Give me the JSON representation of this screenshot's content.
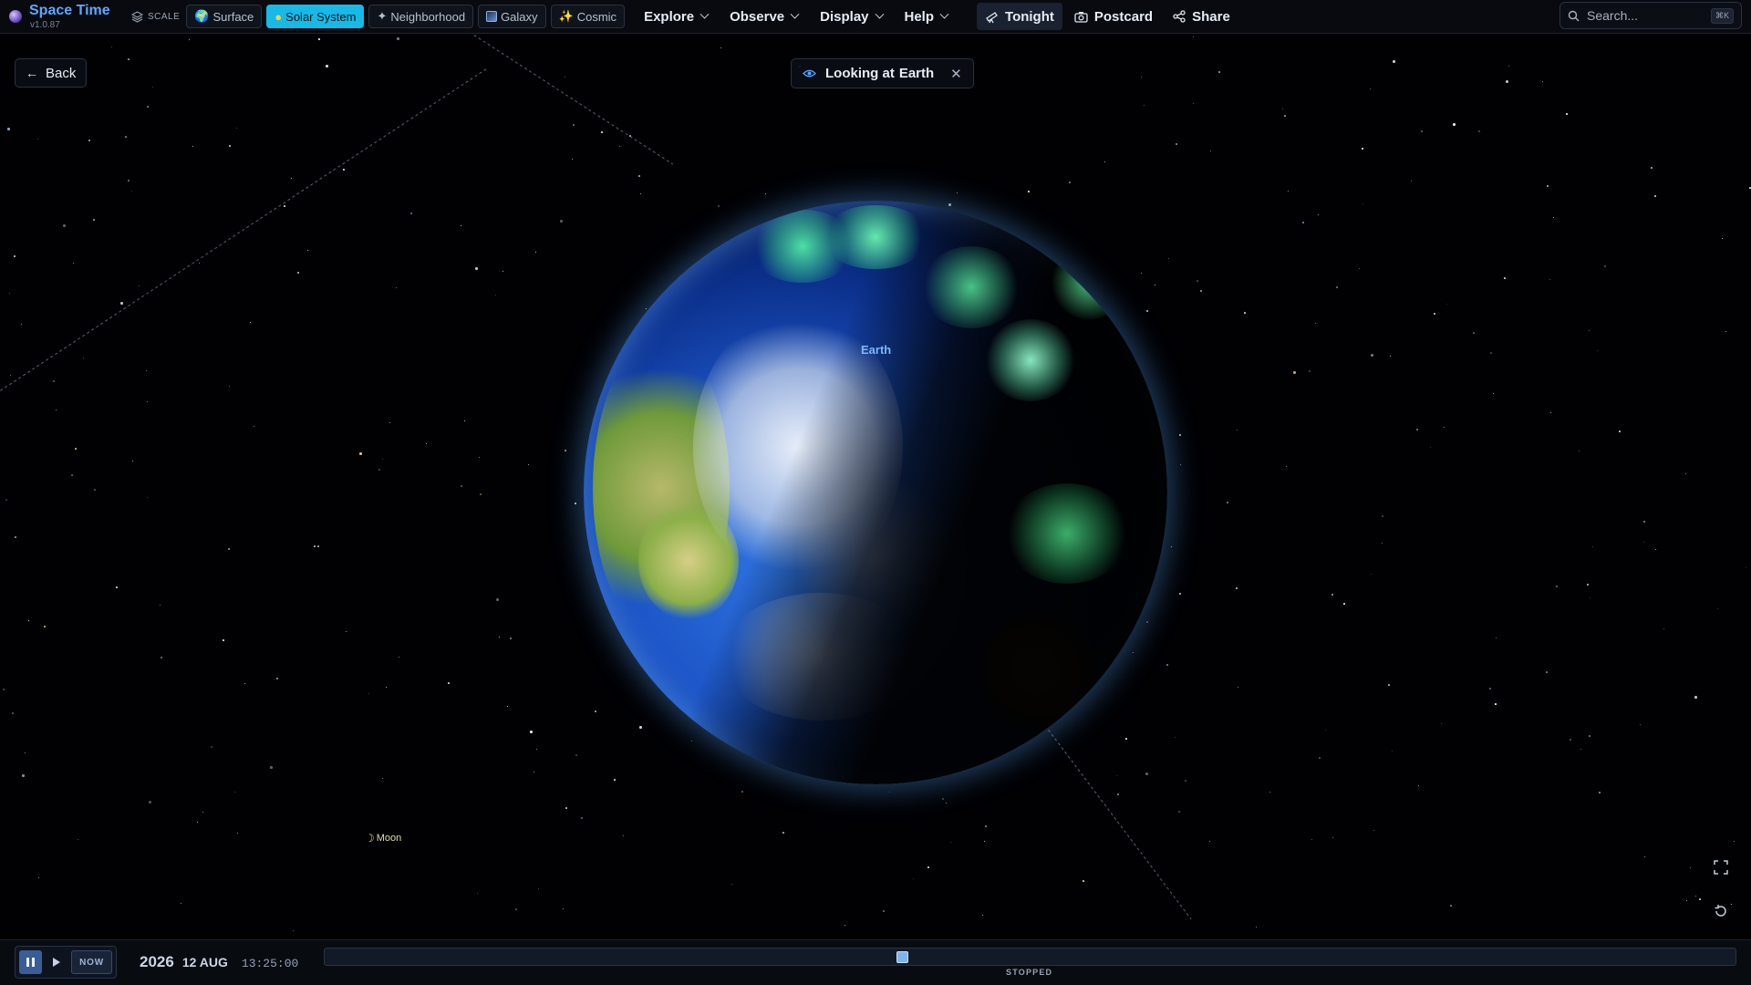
{
  "app": {
    "title": "Space Time",
    "version": "v1.0.87"
  },
  "scale": {
    "label": "SCALE",
    "options": [
      {
        "label": "Surface",
        "icon": "globe-icon",
        "active": false
      },
      {
        "label": "Solar System",
        "icon": "sun-icon",
        "active": true
      },
      {
        "label": "Neighborhood",
        "icon": "sparkle-icon",
        "active": false
      },
      {
        "label": "Galaxy",
        "icon": "galaxy-icon",
        "active": false
      },
      {
        "label": "Cosmic",
        "icon": "cosmic-icon",
        "active": false
      }
    ]
  },
  "menus": [
    "Explore",
    "Observe",
    "Display",
    "Help"
  ],
  "actions": {
    "tonight": "Tonight",
    "postcard": "Postcard",
    "share": "Share"
  },
  "search": {
    "placeholder": "Search...",
    "shortcut": "⌘K"
  },
  "nav": {
    "back": "Back"
  },
  "focus": {
    "prefix": "Looking at",
    "target": "Earth"
  },
  "scene": {
    "primary_label": "Earth",
    "moon_label": "Moon"
  },
  "time": {
    "year": "2026",
    "day_month": "12 AUG",
    "clock": "13:25:00",
    "now_label": "NOW",
    "status": "STOPPED",
    "timeline_position": 0.409
  },
  "colors": {
    "accent": "#17b9e6",
    "brand": "#5ea8ff",
    "label": "#7fb6ff"
  }
}
